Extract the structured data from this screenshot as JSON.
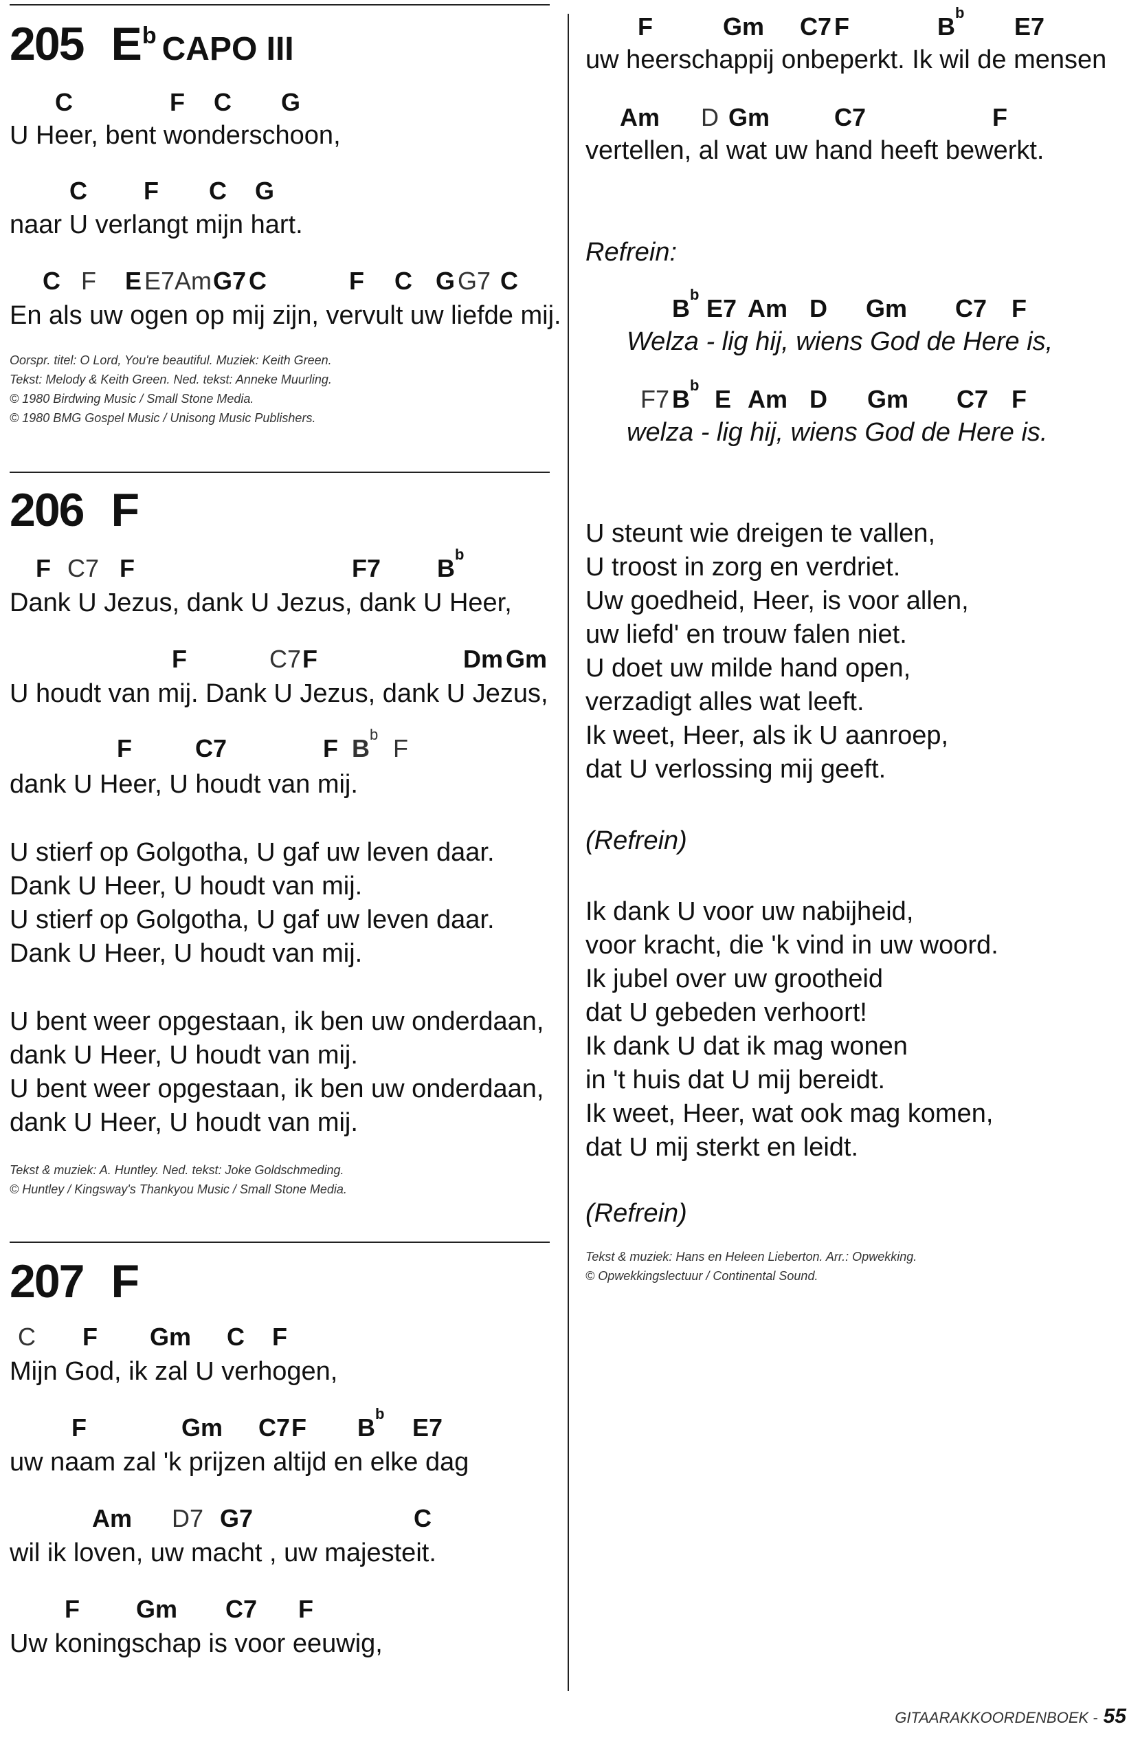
{
  "songs": [
    {
      "number": "205",
      "key_main": "E",
      "key_sup": "b",
      "capo": "CAPO III",
      "lines": [
        {
          "chords": [
            "C",
            "F",
            "C",
            "G"
          ],
          "text": "U Heer, bent wonderschoon,"
        },
        {
          "chords": [
            "C",
            "F",
            "C",
            "G"
          ],
          "text": "naar U verlangt mijn hart."
        },
        {
          "chords": [
            "C",
            "F",
            "E",
            "E7",
            "Am",
            "G7",
            "C",
            "F",
            "C",
            "G",
            "G7",
            "C"
          ],
          "text": "En als uw ogen op mij zijn, vervult uw liefde mij."
        }
      ],
      "credits": [
        "Oorspr. titel: O Lord, You're beautiful. Muziek: Keith Green.",
        "Tekst: Melody & Keith Green. Ned. tekst: Anneke Muurling.",
        "© 1980 Birdwing Music / Small Stone Media.",
        "© 1980 BMG Gospel Music / Unisong Music Publishers."
      ]
    },
    {
      "number": "206",
      "key_main": "F",
      "lines": [
        {
          "chords": [
            "F",
            "C7",
            "F",
            "F7",
            "B"
          ],
          "text": "Dank U Jezus, dank U Jezus, dank U Heer,"
        },
        {
          "chords": [
            "F",
            "C7",
            "F",
            "Dm",
            "Gm"
          ],
          "text": "U houdt van mij.  Dank U Jezus, dank U Jezus,"
        },
        {
          "chords": [
            "F",
            "C7",
            "F",
            "B",
            "F"
          ],
          "text": "dank U Heer, U houdt van mij."
        }
      ],
      "verses": [
        [
          "U stierf op Golgotha, U gaf uw leven daar.",
          "Dank U Heer, U houdt van mij.",
          "U stierf op Golgotha, U gaf uw leven daar.",
          "Dank U Heer, U houdt van mij."
        ],
        [
          "U bent weer opgestaan, ik ben uw onderdaan,",
          "dank U Heer, U houdt van mij.",
          "U bent weer opgestaan, ik ben uw onderdaan,",
          "dank U Heer, U houdt van mij."
        ]
      ],
      "credits": [
        "Tekst & muziek: A. Huntley. Ned. tekst: Joke Goldschmeding.",
        "© Huntley / Kingsway's Thankyou Music / Small Stone Media."
      ]
    },
    {
      "number": "207",
      "key_main": "F",
      "lines": [
        {
          "chords": [
            "C",
            "F",
            "Gm",
            "C",
            "F"
          ],
          "text": "Mijn God, ik zal U verhogen,"
        },
        {
          "chords": [
            "F",
            "Gm",
            "C7",
            "F",
            "B",
            "E7"
          ],
          "text": "uw naam zal 'k prijzen altijd en elke dag"
        },
        {
          "chords": [
            "Am",
            "D7",
            "G7",
            "C"
          ],
          "text": "wil ik loven,   uw macht , uw majesteit."
        },
        {
          "chords": [
            "F",
            "Gm",
            "C7",
            "F"
          ],
          "text": "Uw koningschap is voor eeuwig,"
        }
      ],
      "right_lines": [
        {
          "chords": [
            "F",
            "Gm",
            "C7",
            "F",
            "B",
            "E7"
          ],
          "text": "uw heerschappij onbeperkt. Ik wil de mensen"
        },
        {
          "chords": [
            "Am",
            "D",
            "Gm",
            "C7",
            "F"
          ],
          "text": "vertellen, al wat uw hand heeft bewerkt."
        }
      ],
      "refrein_label": "Refrein:",
      "refrein_lines": [
        {
          "chords": [
            "B",
            "E7",
            "Am",
            "D",
            "Gm",
            "C7",
            "F"
          ],
          "text": "Welza - lig hij, wiens God de Here is,"
        },
        {
          "chords": [
            "F7",
            "B",
            "E",
            "Am",
            "D",
            "Gm",
            "C7",
            "F"
          ],
          "text": "welza - lig hij, wiens God de Here is."
        }
      ],
      "verses": [
        [
          "U steunt wie dreigen te vallen,",
          "U troost in zorg en verdriet.",
          "Uw goedheid, Heer, is voor allen,",
          "uw liefd' en trouw falen niet.",
          "U doet uw milde hand open,",
          "verzadigt alles wat leeft.",
          "Ik weet, Heer, als ik U aanroep,",
          "dat U verlossing mij geeft."
        ],
        [
          "Ik dank U voor uw nabijheid,",
          "voor kracht, die 'k vind in uw woord.",
          "Ik jubel over uw grootheid",
          "dat U gebeden verhoort!",
          "Ik dank U dat ik mag wonen",
          "in 't huis dat U mij bereidt.",
          "Ik weet, Heer, wat ook mag komen,",
          "dat U mij sterkt en leidt."
        ]
      ],
      "refrein_repeat": "(Refrein)",
      "credits": [
        "Tekst & muziek: Hans en Heleen Lieberton. Arr.: Opwekking.",
        "© Opwekkingslectuur / Continental Sound."
      ]
    }
  ],
  "footer": {
    "book": "GITAARAKKOORDENBOEK -",
    "page": "55"
  }
}
